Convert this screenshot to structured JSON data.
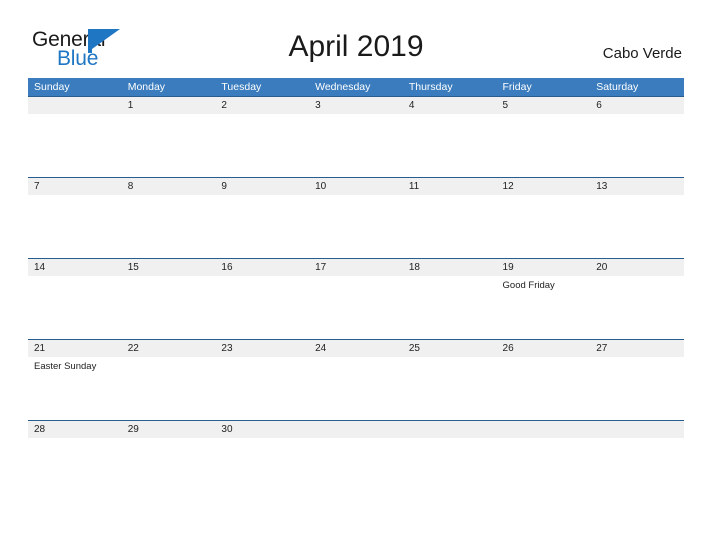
{
  "logo": {
    "word_one": "General",
    "word_two": "Blue",
    "flag_icon": "blue-flag-triangle",
    "color_primary": "#1f77c4",
    "color_text": "#1a1a1a"
  },
  "header": {
    "month_title": "April 2019",
    "country": "Cabo Verde"
  },
  "theme": {
    "header_blue": "#3a7cbe",
    "row_divider_blue": "#2a5d8f",
    "day_strip_gray": "#f0f0f0",
    "text_dark": "#222222"
  },
  "calendar": {
    "weekdays": [
      "Sunday",
      "Monday",
      "Tuesday",
      "Wednesday",
      "Thursday",
      "Friday",
      "Saturday"
    ],
    "weeks": [
      {
        "days": [
          {
            "number": "",
            "event": ""
          },
          {
            "number": "1",
            "event": ""
          },
          {
            "number": "2",
            "event": ""
          },
          {
            "number": "3",
            "event": ""
          },
          {
            "number": "4",
            "event": ""
          },
          {
            "number": "5",
            "event": ""
          },
          {
            "number": "6",
            "event": ""
          }
        ]
      },
      {
        "days": [
          {
            "number": "7",
            "event": ""
          },
          {
            "number": "8",
            "event": ""
          },
          {
            "number": "9",
            "event": ""
          },
          {
            "number": "10",
            "event": ""
          },
          {
            "number": "11",
            "event": ""
          },
          {
            "number": "12",
            "event": ""
          },
          {
            "number": "13",
            "event": ""
          }
        ]
      },
      {
        "days": [
          {
            "number": "14",
            "event": ""
          },
          {
            "number": "15",
            "event": ""
          },
          {
            "number": "16",
            "event": ""
          },
          {
            "number": "17",
            "event": ""
          },
          {
            "number": "18",
            "event": ""
          },
          {
            "number": "19",
            "event": "Good Friday"
          },
          {
            "number": "20",
            "event": ""
          }
        ]
      },
      {
        "days": [
          {
            "number": "21",
            "event": "Easter Sunday"
          },
          {
            "number": "22",
            "event": ""
          },
          {
            "number": "23",
            "event": ""
          },
          {
            "number": "24",
            "event": ""
          },
          {
            "number": "25",
            "event": ""
          },
          {
            "number": "26",
            "event": ""
          },
          {
            "number": "27",
            "event": ""
          }
        ]
      },
      {
        "days": [
          {
            "number": "28",
            "event": ""
          },
          {
            "number": "29",
            "event": ""
          },
          {
            "number": "30",
            "event": ""
          },
          {
            "number": "",
            "event": ""
          },
          {
            "number": "",
            "event": ""
          },
          {
            "number": "",
            "event": ""
          },
          {
            "number": "",
            "event": ""
          }
        ]
      }
    ]
  }
}
